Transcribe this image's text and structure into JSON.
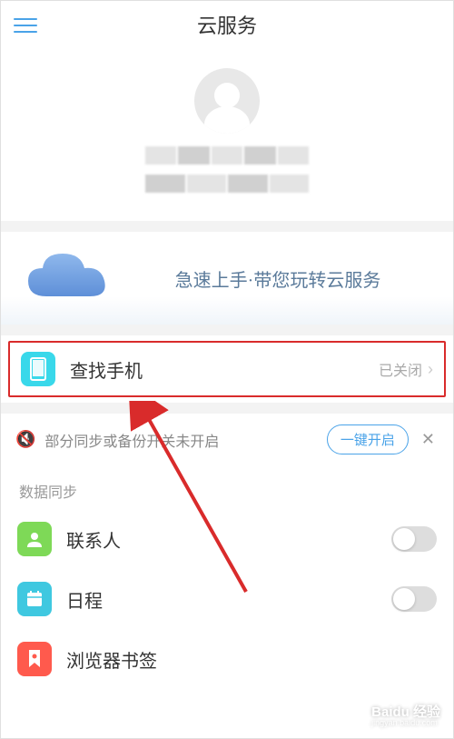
{
  "header": {
    "title": "云服务"
  },
  "promo": {
    "text": "急速上手·带您玩转云服务"
  },
  "findPhone": {
    "label": "查找手机",
    "status": "已关闭"
  },
  "notice": {
    "text": "部分同步或备份开关未开启",
    "button": "一键开启"
  },
  "section": {
    "title": "数据同步"
  },
  "sync": {
    "contacts": {
      "label": "联系人"
    },
    "calendar": {
      "label": "日程"
    },
    "bookmarks": {
      "label": "浏览器书签"
    }
  },
  "watermark": {
    "brand": "Baidu 经验",
    "url": "jingyan.baidu.com"
  }
}
